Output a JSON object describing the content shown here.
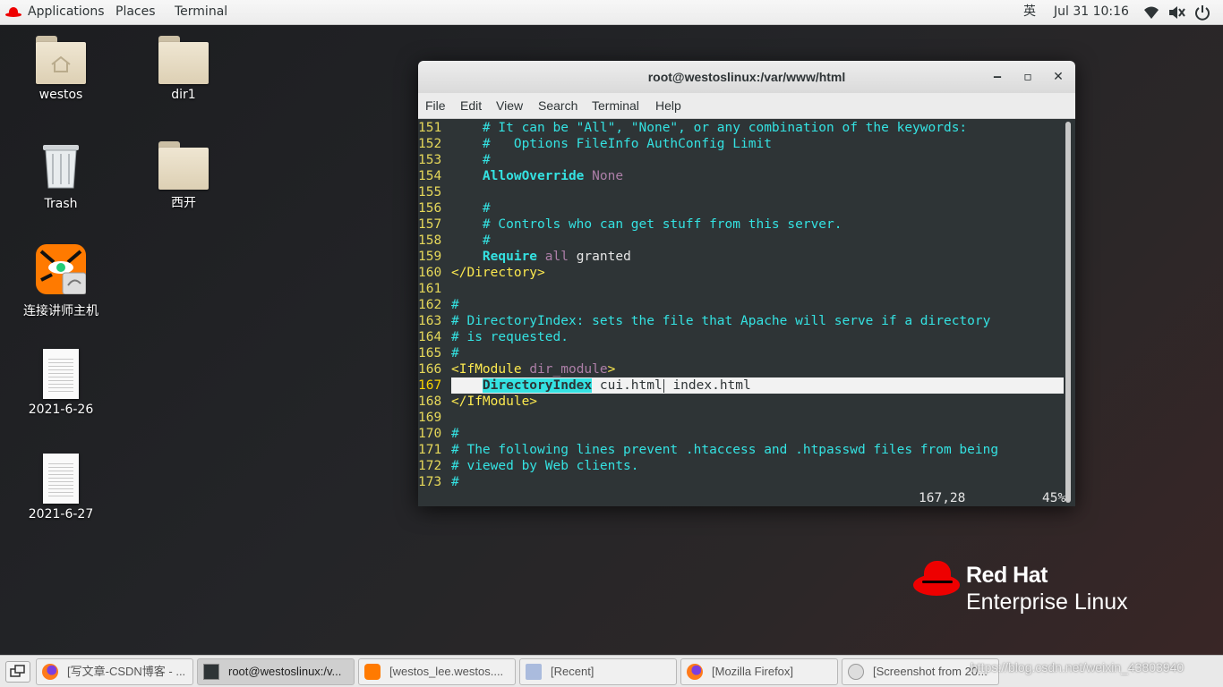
{
  "topbar": {
    "applications": "Applications",
    "places": "Places",
    "terminal": "Terminal",
    "input_method": "英",
    "clock": "Jul 31  10:16",
    "tray_icons": [
      "wifi-icon",
      "volume-icon",
      "power-icon"
    ]
  },
  "desktop": {
    "icons": [
      {
        "label": "westos",
        "icon": "home-folder-icon"
      },
      {
        "label": "dir1",
        "icon": "folder-icon"
      },
      {
        "label": "Trash",
        "icon": "trash-icon"
      },
      {
        "label": "西开",
        "icon": "folder-icon"
      },
      {
        "label": "连接讲师主机",
        "icon": "remote-viewer-icon"
      },
      {
        "label": "2021-6-26",
        "icon": "document-icon"
      },
      {
        "label": "2021-6-27",
        "icon": "document-icon"
      }
    ]
  },
  "window": {
    "title": "root@westoslinux:/var/www/html",
    "controls": {
      "minimize": "‒",
      "maximize": "▫",
      "close": "✕"
    },
    "menu": [
      "File",
      "Edit",
      "View",
      "Search",
      "Terminal",
      "Help"
    ],
    "lines": [
      {
        "n": "151",
        "text": "    # It can be \"All\", \"None\", or any combination of the keywords:"
      },
      {
        "n": "152",
        "text": "    #   Options FileInfo AuthConfig Limit"
      },
      {
        "n": "153",
        "text": "    #"
      },
      {
        "n": "154",
        "key": "AllowOverride",
        "val": "None"
      },
      {
        "n": "155",
        "text": ""
      },
      {
        "n": "156",
        "text": "    #"
      },
      {
        "n": "157",
        "text": "    # Controls who can get stuff from this server."
      },
      {
        "n": "158",
        "text": "    #"
      },
      {
        "n": "159",
        "key": "Require",
        "val": "all",
        "rest": "granted"
      },
      {
        "n": "160",
        "tag": "</Directory>"
      },
      {
        "n": "161",
        "text": ""
      },
      {
        "n": "162",
        "text": "#"
      },
      {
        "n": "163",
        "text": "# DirectoryIndex: sets the file that Apache will serve if a directory"
      },
      {
        "n": "164",
        "text": "# is requested."
      },
      {
        "n": "165",
        "text": "#"
      },
      {
        "n": "166",
        "tag_open": "<IfModule",
        "tag_attr": "dir_module",
        "tag_close": ">"
      },
      {
        "n": "167",
        "key": "DirectoryIndex",
        "a": "cui.html",
        "b": "index.html"
      },
      {
        "n": "168",
        "tag": "</IfModule>"
      },
      {
        "n": "169",
        "text": ""
      },
      {
        "n": "170",
        "text": "#"
      },
      {
        "n": "171",
        "text": "# The following lines prevent .htaccess and .htpasswd files from being"
      },
      {
        "n": "172",
        "text": "# viewed by Web clients."
      },
      {
        "n": "173",
        "text": "#"
      }
    ],
    "status_position": "167,28",
    "status_percent": "45%"
  },
  "branding": {
    "line1": "Red Hat",
    "line2": "Enterprise Linux"
  },
  "taskbar": {
    "tasks": [
      {
        "label": "[写文章-CSDN博客 - ...",
        "icon": "firefox-icon"
      },
      {
        "label": "root@westoslinux:/v...",
        "icon": "terminal-icon",
        "active": true
      },
      {
        "label": "[westos_lee.westos....",
        "icon": "remote-viewer-icon"
      },
      {
        "label": "[Recent]",
        "icon": "files-icon"
      },
      {
        "label": "[Mozilla Firefox]",
        "icon": "firefox-icon"
      },
      {
        "label": "[Screenshot from 20...",
        "icon": "screenshot-icon"
      }
    ],
    "watermark": "https://blog.csdn.net/weixin_43803940"
  }
}
